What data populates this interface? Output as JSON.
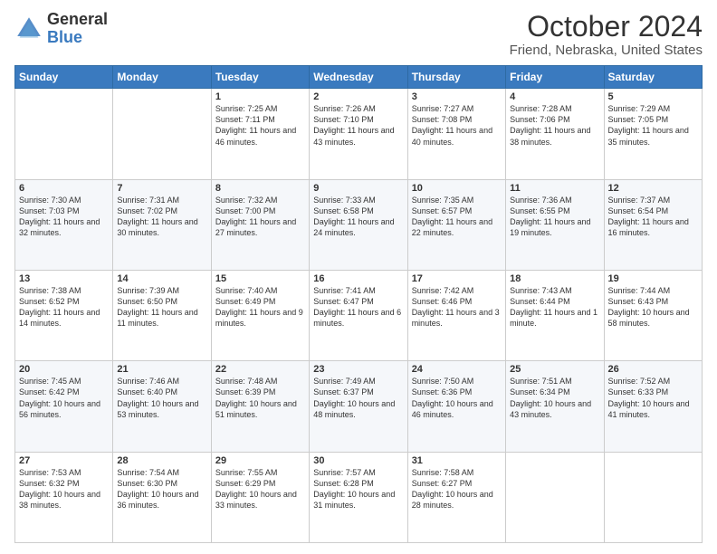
{
  "logo": {
    "general": "General",
    "blue": "Blue"
  },
  "title": "October 2024",
  "subtitle": "Friend, Nebraska, United States",
  "days_of_week": [
    "Sunday",
    "Monday",
    "Tuesday",
    "Wednesday",
    "Thursday",
    "Friday",
    "Saturday"
  ],
  "weeks": [
    [
      {
        "day": "",
        "sunrise": "",
        "sunset": "",
        "daylight": ""
      },
      {
        "day": "",
        "sunrise": "",
        "sunset": "",
        "daylight": ""
      },
      {
        "day": "1",
        "sunrise": "Sunrise: 7:25 AM",
        "sunset": "Sunset: 7:11 PM",
        "daylight": "Daylight: 11 hours and 46 minutes."
      },
      {
        "day": "2",
        "sunrise": "Sunrise: 7:26 AM",
        "sunset": "Sunset: 7:10 PM",
        "daylight": "Daylight: 11 hours and 43 minutes."
      },
      {
        "day": "3",
        "sunrise": "Sunrise: 7:27 AM",
        "sunset": "Sunset: 7:08 PM",
        "daylight": "Daylight: 11 hours and 40 minutes."
      },
      {
        "day": "4",
        "sunrise": "Sunrise: 7:28 AM",
        "sunset": "Sunset: 7:06 PM",
        "daylight": "Daylight: 11 hours and 38 minutes."
      },
      {
        "day": "5",
        "sunrise": "Sunrise: 7:29 AM",
        "sunset": "Sunset: 7:05 PM",
        "daylight": "Daylight: 11 hours and 35 minutes."
      }
    ],
    [
      {
        "day": "6",
        "sunrise": "Sunrise: 7:30 AM",
        "sunset": "Sunset: 7:03 PM",
        "daylight": "Daylight: 11 hours and 32 minutes."
      },
      {
        "day": "7",
        "sunrise": "Sunrise: 7:31 AM",
        "sunset": "Sunset: 7:02 PM",
        "daylight": "Daylight: 11 hours and 30 minutes."
      },
      {
        "day": "8",
        "sunrise": "Sunrise: 7:32 AM",
        "sunset": "Sunset: 7:00 PM",
        "daylight": "Daylight: 11 hours and 27 minutes."
      },
      {
        "day": "9",
        "sunrise": "Sunrise: 7:33 AM",
        "sunset": "Sunset: 6:58 PM",
        "daylight": "Daylight: 11 hours and 24 minutes."
      },
      {
        "day": "10",
        "sunrise": "Sunrise: 7:35 AM",
        "sunset": "Sunset: 6:57 PM",
        "daylight": "Daylight: 11 hours and 22 minutes."
      },
      {
        "day": "11",
        "sunrise": "Sunrise: 7:36 AM",
        "sunset": "Sunset: 6:55 PM",
        "daylight": "Daylight: 11 hours and 19 minutes."
      },
      {
        "day": "12",
        "sunrise": "Sunrise: 7:37 AM",
        "sunset": "Sunset: 6:54 PM",
        "daylight": "Daylight: 11 hours and 16 minutes."
      }
    ],
    [
      {
        "day": "13",
        "sunrise": "Sunrise: 7:38 AM",
        "sunset": "Sunset: 6:52 PM",
        "daylight": "Daylight: 11 hours and 14 minutes."
      },
      {
        "day": "14",
        "sunrise": "Sunrise: 7:39 AM",
        "sunset": "Sunset: 6:50 PM",
        "daylight": "Daylight: 11 hours and 11 minutes."
      },
      {
        "day": "15",
        "sunrise": "Sunrise: 7:40 AM",
        "sunset": "Sunset: 6:49 PM",
        "daylight": "Daylight: 11 hours and 9 minutes."
      },
      {
        "day": "16",
        "sunrise": "Sunrise: 7:41 AM",
        "sunset": "Sunset: 6:47 PM",
        "daylight": "Daylight: 11 hours and 6 minutes."
      },
      {
        "day": "17",
        "sunrise": "Sunrise: 7:42 AM",
        "sunset": "Sunset: 6:46 PM",
        "daylight": "Daylight: 11 hours and 3 minutes."
      },
      {
        "day": "18",
        "sunrise": "Sunrise: 7:43 AM",
        "sunset": "Sunset: 6:44 PM",
        "daylight": "Daylight: 11 hours and 1 minute."
      },
      {
        "day": "19",
        "sunrise": "Sunrise: 7:44 AM",
        "sunset": "Sunset: 6:43 PM",
        "daylight": "Daylight: 10 hours and 58 minutes."
      }
    ],
    [
      {
        "day": "20",
        "sunrise": "Sunrise: 7:45 AM",
        "sunset": "Sunset: 6:42 PM",
        "daylight": "Daylight: 10 hours and 56 minutes."
      },
      {
        "day": "21",
        "sunrise": "Sunrise: 7:46 AM",
        "sunset": "Sunset: 6:40 PM",
        "daylight": "Daylight: 10 hours and 53 minutes."
      },
      {
        "day": "22",
        "sunrise": "Sunrise: 7:48 AM",
        "sunset": "Sunset: 6:39 PM",
        "daylight": "Daylight: 10 hours and 51 minutes."
      },
      {
        "day": "23",
        "sunrise": "Sunrise: 7:49 AM",
        "sunset": "Sunset: 6:37 PM",
        "daylight": "Daylight: 10 hours and 48 minutes."
      },
      {
        "day": "24",
        "sunrise": "Sunrise: 7:50 AM",
        "sunset": "Sunset: 6:36 PM",
        "daylight": "Daylight: 10 hours and 46 minutes."
      },
      {
        "day": "25",
        "sunrise": "Sunrise: 7:51 AM",
        "sunset": "Sunset: 6:34 PM",
        "daylight": "Daylight: 10 hours and 43 minutes."
      },
      {
        "day": "26",
        "sunrise": "Sunrise: 7:52 AM",
        "sunset": "Sunset: 6:33 PM",
        "daylight": "Daylight: 10 hours and 41 minutes."
      }
    ],
    [
      {
        "day": "27",
        "sunrise": "Sunrise: 7:53 AM",
        "sunset": "Sunset: 6:32 PM",
        "daylight": "Daylight: 10 hours and 38 minutes."
      },
      {
        "day": "28",
        "sunrise": "Sunrise: 7:54 AM",
        "sunset": "Sunset: 6:30 PM",
        "daylight": "Daylight: 10 hours and 36 minutes."
      },
      {
        "day": "29",
        "sunrise": "Sunrise: 7:55 AM",
        "sunset": "Sunset: 6:29 PM",
        "daylight": "Daylight: 10 hours and 33 minutes."
      },
      {
        "day": "30",
        "sunrise": "Sunrise: 7:57 AM",
        "sunset": "Sunset: 6:28 PM",
        "daylight": "Daylight: 10 hours and 31 minutes."
      },
      {
        "day": "31",
        "sunrise": "Sunrise: 7:58 AM",
        "sunset": "Sunset: 6:27 PM",
        "daylight": "Daylight: 10 hours and 28 minutes."
      },
      {
        "day": "",
        "sunrise": "",
        "sunset": "",
        "daylight": ""
      },
      {
        "day": "",
        "sunrise": "",
        "sunset": "",
        "daylight": ""
      }
    ]
  ]
}
